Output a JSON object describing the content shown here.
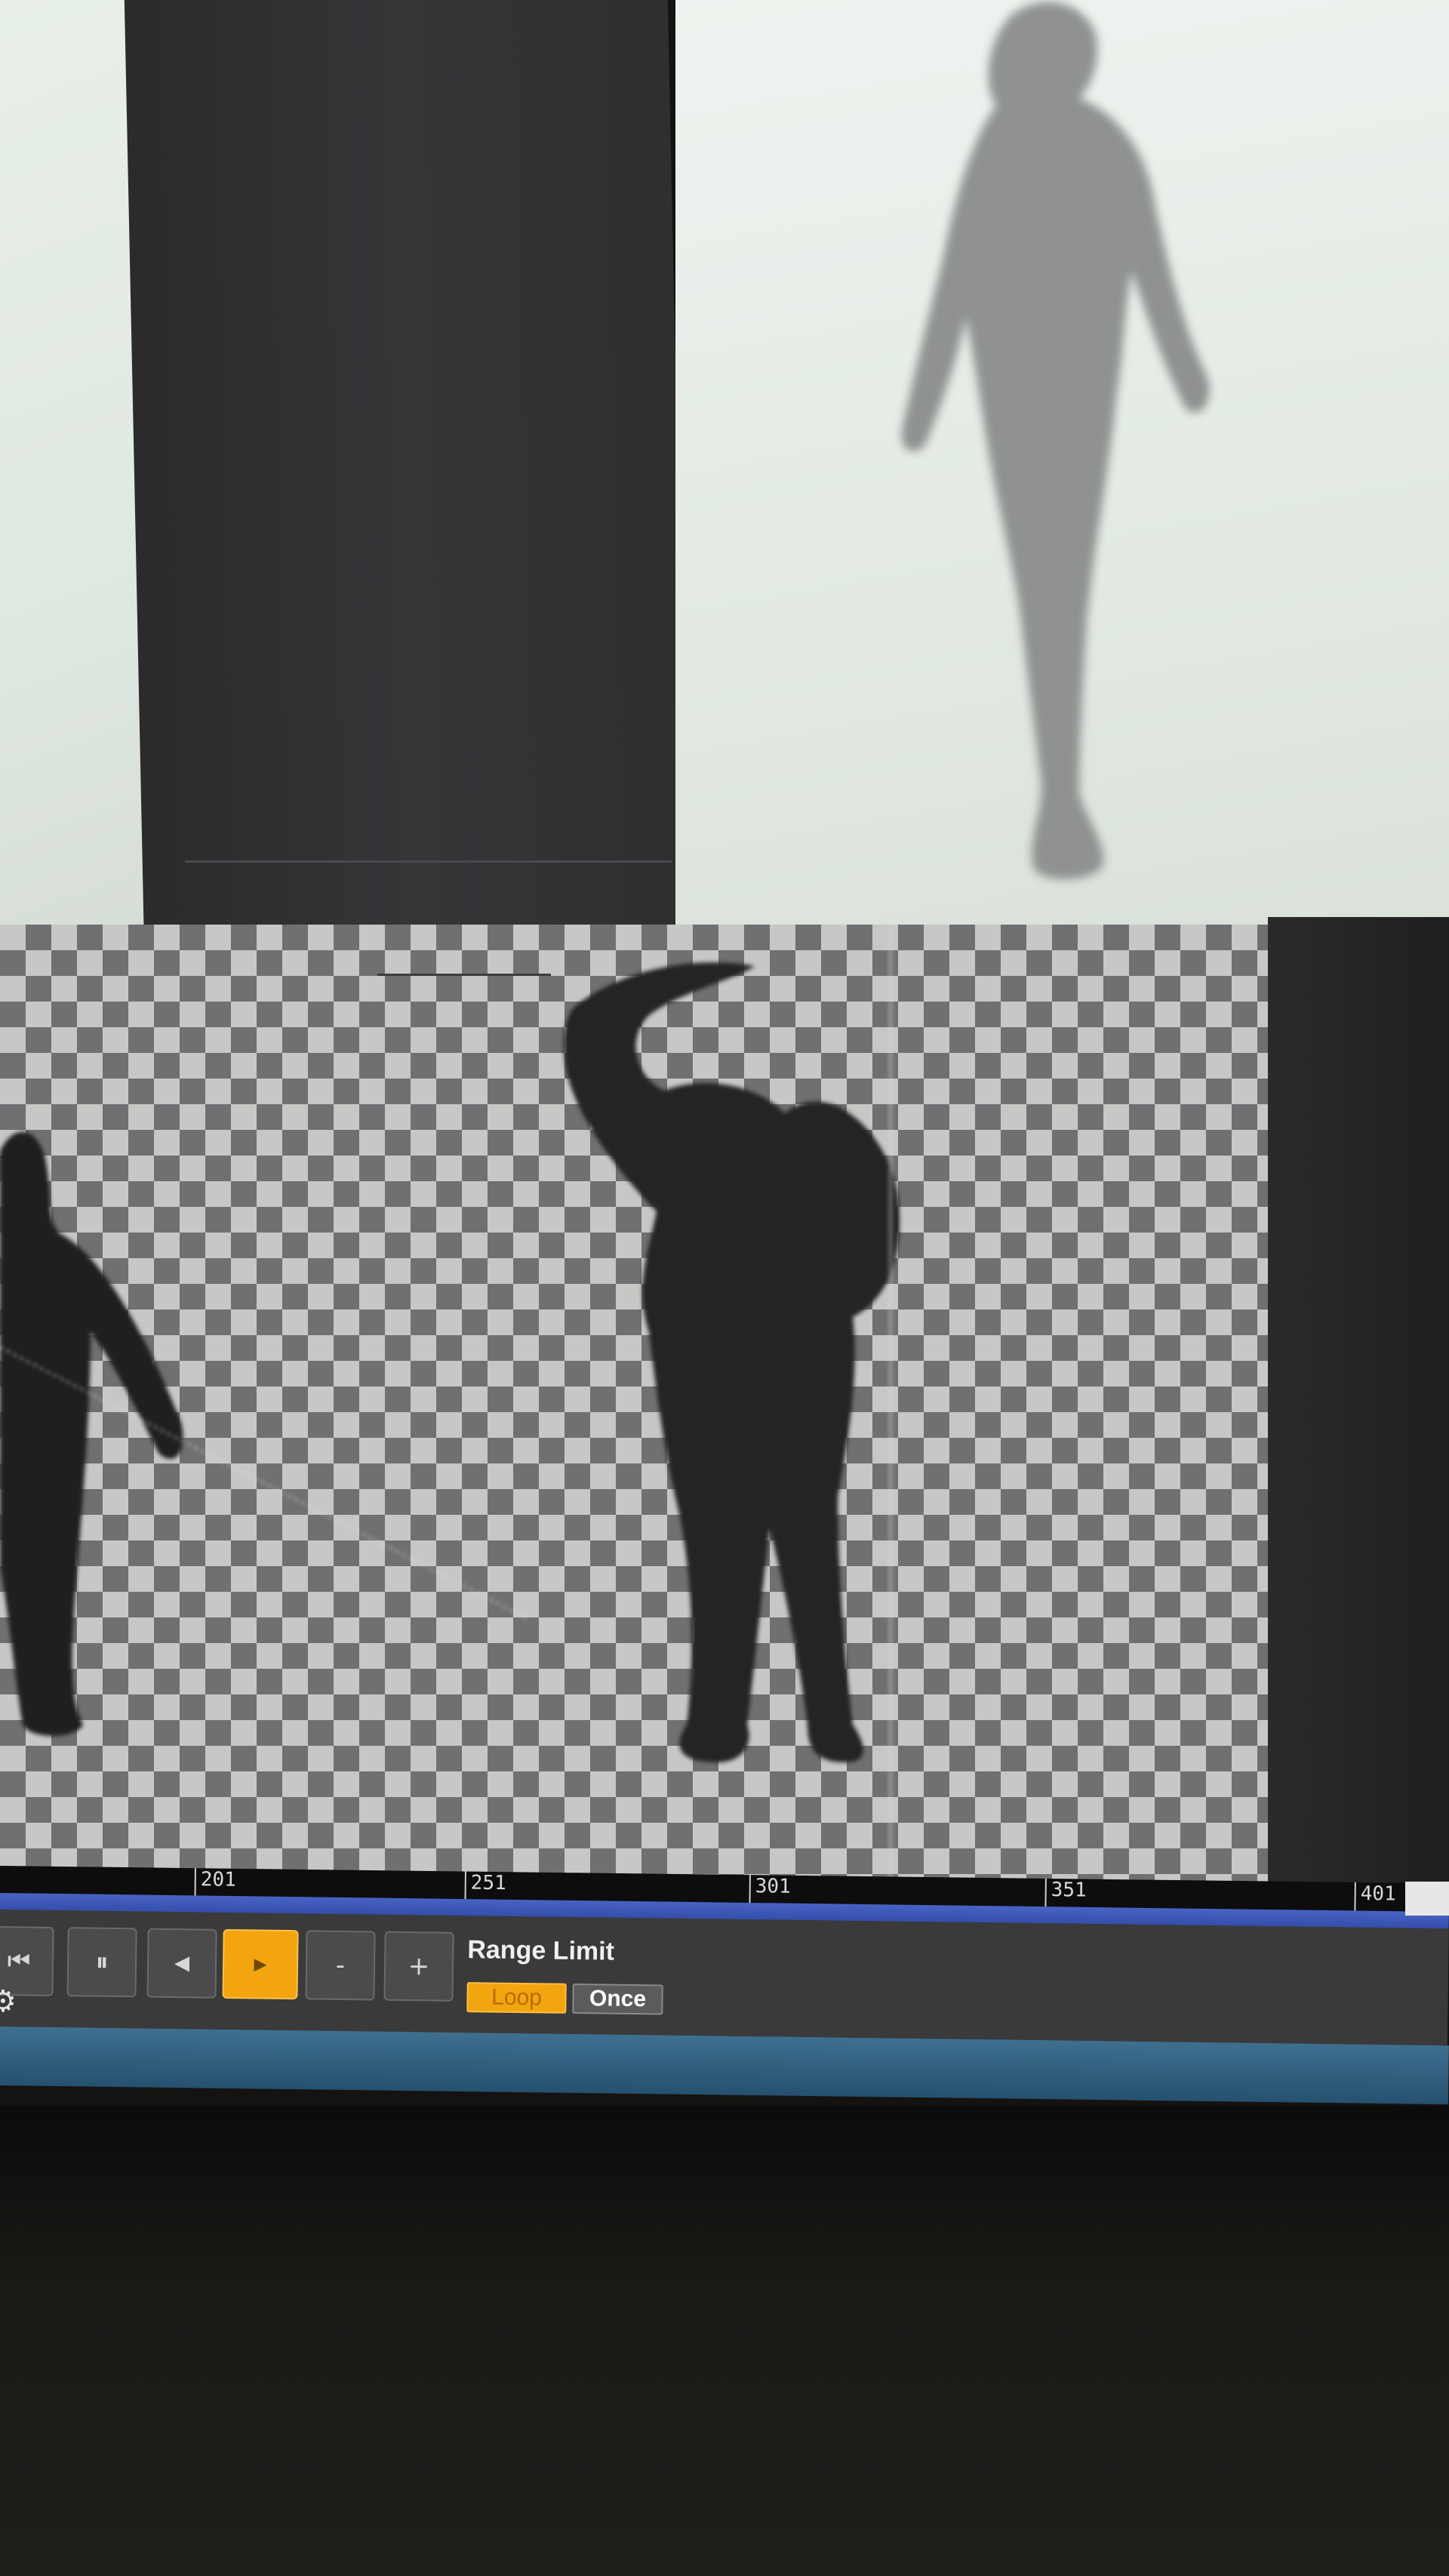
{
  "timeline": {
    "ticks": [
      "201",
      "251",
      "301",
      "351",
      "401"
    ]
  },
  "transport": {
    "icons": {
      "first": "⏮",
      "pause": "⏸",
      "back": "◀",
      "play": "▶",
      "minus": "-",
      "plus": "+"
    },
    "range_limit_label": "Range Limit",
    "loop_label": "Loop",
    "once_label": "Once",
    "active_mode": "Loop",
    "playing": true
  },
  "colors": {
    "accent_orange": "#f2a50f",
    "timeline_blue": "#3b55b6",
    "status_blue": "#2f5d7e"
  }
}
